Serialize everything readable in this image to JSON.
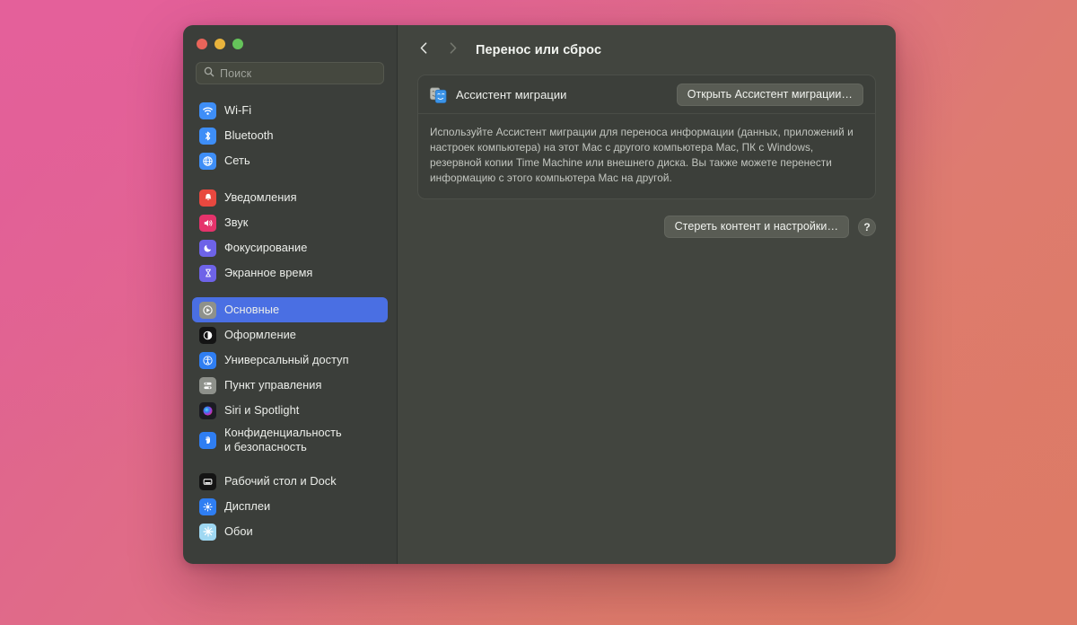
{
  "window": {
    "traffic_lights": [
      {
        "name": "close",
        "color": "#e8645a"
      },
      {
        "name": "minimize",
        "color": "#e8b33c"
      },
      {
        "name": "zoom",
        "color": "#65c35a"
      }
    ]
  },
  "sidebar": {
    "search": {
      "placeholder": "Поиск",
      "value": ""
    },
    "groups": [
      {
        "items": [
          {
            "label": "Wi-Fi",
            "icon": "wifi-icon",
            "selected": false
          },
          {
            "label": "Bluetooth",
            "icon": "bluetooth-icon",
            "selected": false
          },
          {
            "label": "Сеть",
            "icon": "network-globe-icon",
            "selected": false
          }
        ]
      },
      {
        "items": [
          {
            "label": "Уведомления",
            "icon": "notifications-bell-icon",
            "selected": false
          },
          {
            "label": "Звук",
            "icon": "sound-speaker-icon",
            "selected": false
          },
          {
            "label": "Фокусирование",
            "icon": "focus-moon-icon",
            "selected": false
          },
          {
            "label": "Экранное время",
            "icon": "screen-time-hourglass-icon",
            "selected": false
          }
        ]
      },
      {
        "items": [
          {
            "label": "Основные",
            "icon": "general-gear-icon",
            "selected": true
          },
          {
            "label": "Оформление",
            "icon": "appearance-contrast-icon",
            "selected": false
          },
          {
            "label": "Универсальный доступ",
            "icon": "accessibility-icon",
            "selected": false
          },
          {
            "label": "Пункт управления",
            "icon": "control-center-icon",
            "selected": false
          },
          {
            "label": "Siri и Spotlight",
            "icon": "siri-orb-icon",
            "selected": false
          },
          {
            "label": "Конфиденциальность и безопасность",
            "label_line1": "Конфиденциальность",
            "label_line2": "и безопасность",
            "icon": "privacy-hand-icon",
            "selected": false
          }
        ]
      },
      {
        "items": [
          {
            "label": "Рабочий стол и Dock",
            "icon": "desktop-dock-icon",
            "selected": false
          },
          {
            "label": "Дисплеи",
            "icon": "displays-icon",
            "selected": false
          },
          {
            "label": "Обои",
            "icon": "wallpaper-icon",
            "selected": false
          }
        ]
      }
    ]
  },
  "main": {
    "nav": {
      "back_icon": "chevron-left-icon",
      "forward_icon": "chevron-right-icon"
    },
    "title": "Перенос или сброс",
    "card": {
      "row_label": "Ассистент миграции",
      "row_icon": "migration-assistant-icon",
      "open_button": "Открыть Ассистент миграции…",
      "description": "Используйте Ассистент миграции для переноса информации (данных, приложений и настроек компьютера) на этот Mac с другого компьютера Mac, ПК с Windows, резервной копии Time Machine или внешнего диска. Вы также можете перенести информацию с этого компьютера Mac на другой."
    },
    "erase_button": "Стереть контент и настройки…",
    "help_button": "?"
  },
  "colors": {
    "accent": "#4a6fe3",
    "sidebar_bg": "#3b3e3a",
    "content_bg": "#42453f",
    "card_bg": "#3c3f3a"
  }
}
